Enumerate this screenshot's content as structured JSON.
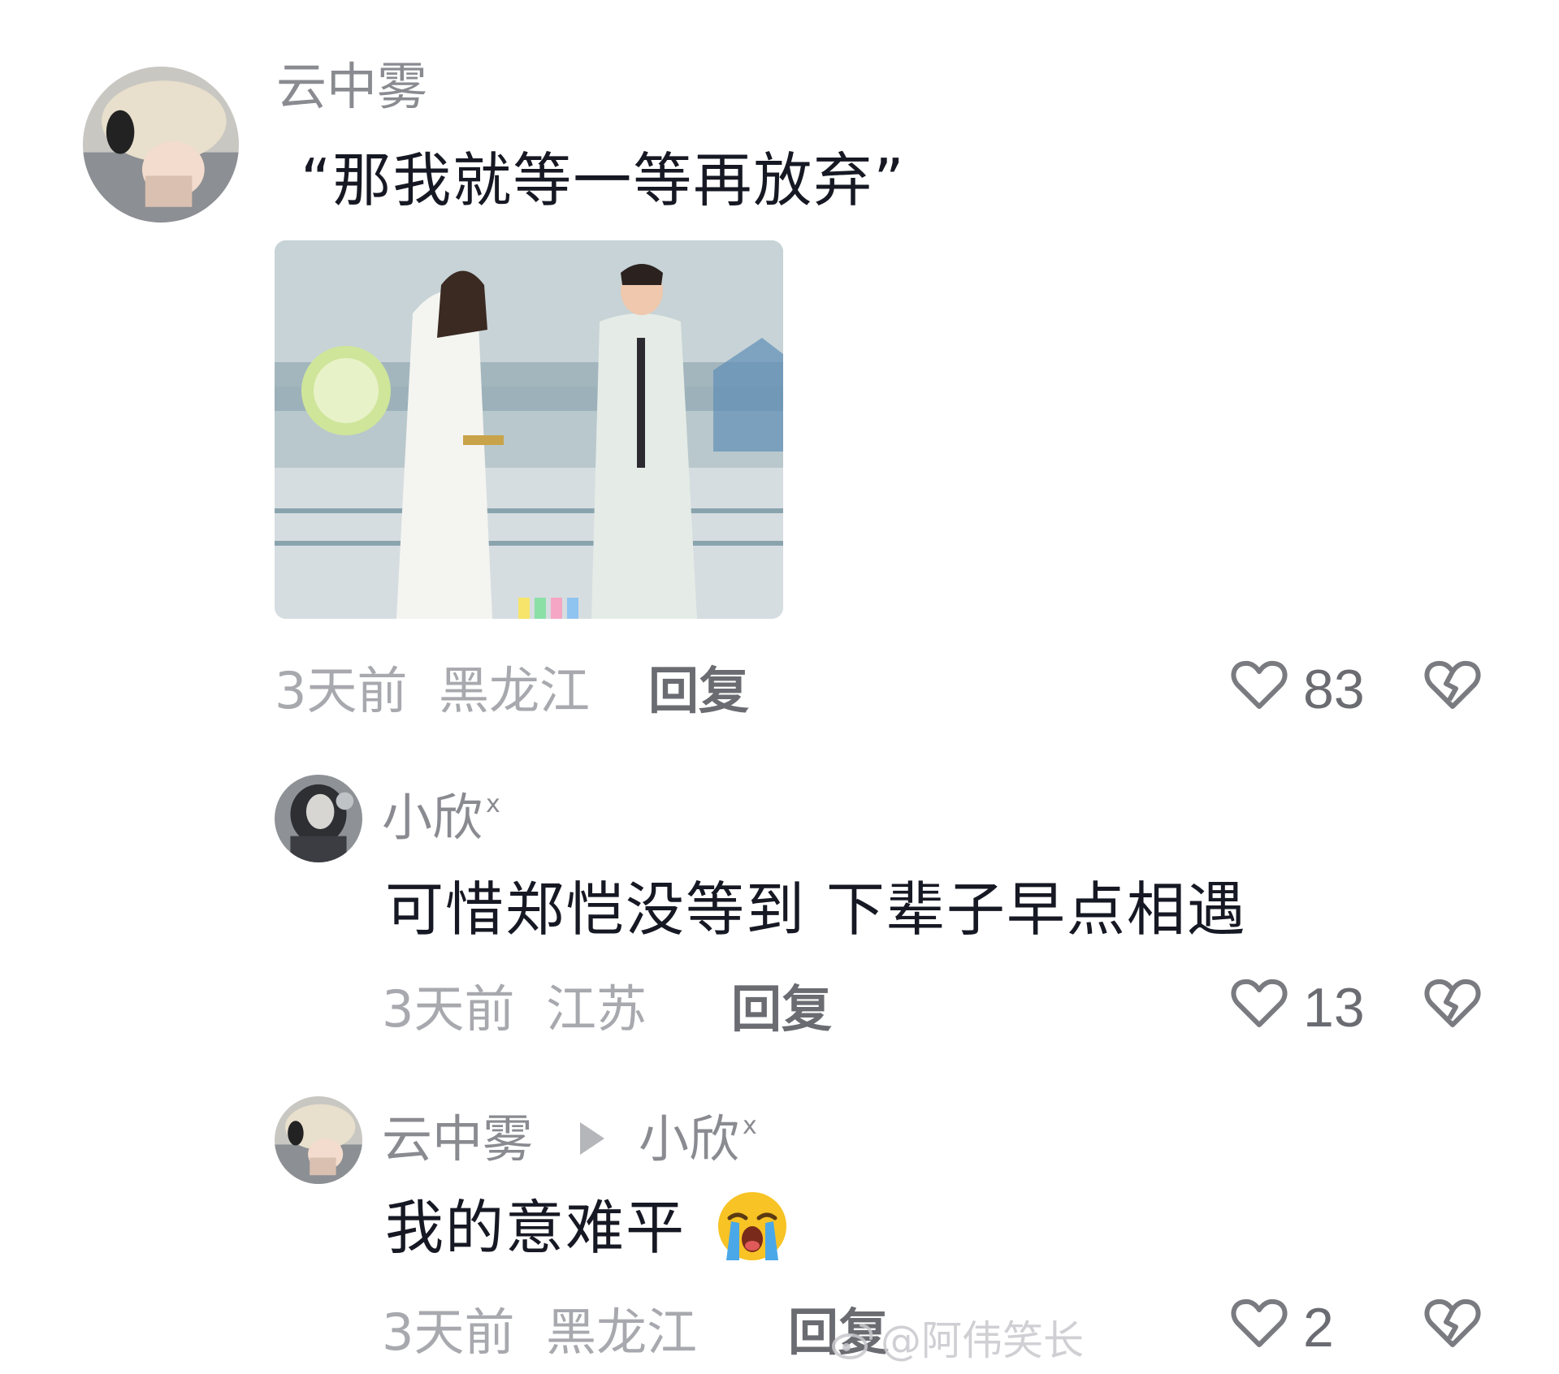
{
  "comments": [
    {
      "username": "云中雾",
      "text": "“那我就等一等再放弃”",
      "time": "3天前",
      "location": "黑龙江",
      "reply_label": "回复",
      "likes": "83",
      "has_image": true
    },
    {
      "username": "小欣",
      "username_sup": "x",
      "text": "可惜郑恺没等到 下辈子早点相遇",
      "time": "3天前",
      "location": "江苏",
      "reply_label": "回复",
      "likes": "13"
    },
    {
      "username": "云中雾",
      "reply_to": "小欣",
      "reply_to_sup": "x",
      "text": "我的意难平",
      "emoji": "loudly-crying-face",
      "time": "3天前",
      "location": "黑龙江",
      "reply_label": "回复",
      "likes": "2"
    }
  ],
  "watermark": "@阿伟笑长",
  "icons": {
    "like": "heart-outline-icon",
    "dislike": "broken-heart-icon",
    "reply_arrow": "triangle-right-icon"
  },
  "colors": {
    "username": "#8a8b91",
    "text": "#161823",
    "meta": "#a8a9ae",
    "reply": "#6b6c72"
  }
}
